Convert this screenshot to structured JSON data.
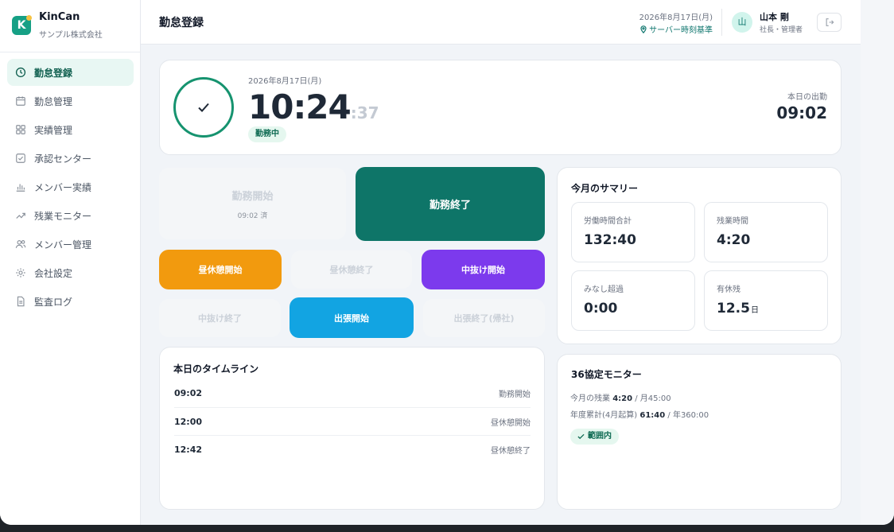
{
  "brand": {
    "name": "KinCan",
    "company": "サンプル株式会社",
    "logo_letter": "K"
  },
  "sidebar": {
    "items": [
      {
        "label": "勤怠登録",
        "icon": "clock-icon",
        "active": true
      },
      {
        "label": "勤怠管理",
        "icon": "calendar-icon"
      },
      {
        "label": "実績管理",
        "icon": "grid-icon"
      },
      {
        "label": "承認センター",
        "icon": "check-square-icon"
      },
      {
        "label": "メンバー実績",
        "icon": "bar-chart-icon"
      },
      {
        "label": "残業モニター",
        "icon": "trend-icon"
      },
      {
        "label": "メンバー管理",
        "icon": "users-icon"
      },
      {
        "label": "会社設定",
        "icon": "gear-icon"
      },
      {
        "label": "監査ログ",
        "icon": "document-icon"
      }
    ]
  },
  "header": {
    "title": "勤怠登録",
    "date": "2026年8月17日(月)",
    "server_label": "サーバー時刻基準",
    "avatar": "山",
    "user_name": "山本 剛",
    "user_role": "社長・管理者"
  },
  "clock": {
    "date": "2026年8月17日(月)",
    "time": "10:24",
    "seconds": ":37",
    "status": "勤務中",
    "clock_in_label": "本日の出勤",
    "clock_in_time": "09:02"
  },
  "actions": {
    "start": "勤務開始",
    "start_sub": "09:02 済",
    "end": "勤務終了",
    "break_start": "昼休憩開始",
    "break_end": "昼休憩終了",
    "out_start": "中抜け開始",
    "out_end": "中抜け終了",
    "trip_start": "出張開始",
    "trip_end": "出張終了(帰社)"
  },
  "timeline": {
    "title": "本日のタイムライン",
    "rows": [
      {
        "time": "09:02",
        "event": "勤務開始"
      },
      {
        "time": "12:00",
        "event": "昼休憩開始"
      },
      {
        "time": "12:42",
        "event": "昼休憩終了"
      }
    ]
  },
  "summary": {
    "title": "今月のサマリー",
    "stats": [
      {
        "label": "労働時間合計",
        "value": "132:40",
        "unit": ""
      },
      {
        "label": "残業時間",
        "value": "4:20",
        "unit": ""
      },
      {
        "label": "みなし超過",
        "value": "0:00",
        "unit": ""
      },
      {
        "label": "有休残",
        "value": "12.5",
        "unit": "日"
      }
    ]
  },
  "monitor": {
    "title": "36協定モニター",
    "month_label": "今月の残業",
    "month_value": "4:20",
    "month_limit": "/ 月45:00",
    "year_label": "年度累計(4月起算)",
    "year_value": "61:40",
    "year_limit": "/ 年360:00",
    "status": "範囲内"
  },
  "colors": {
    "primary": "#0e7568",
    "break_start": "#f29a0e",
    "out_start": "#7c3aed",
    "trip_start": "#12a4e2",
    "status_ok": "#16936f"
  }
}
